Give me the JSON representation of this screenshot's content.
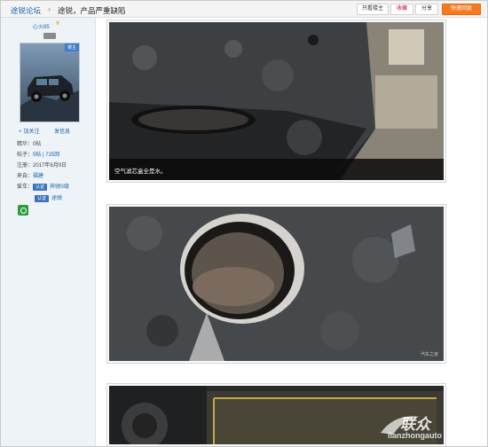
{
  "header": {
    "forum": "途锐论坛",
    "separator": "›",
    "thread_title": "途锐，产品严重缺陷",
    "buttons": {
      "only_author": "只看楼主",
      "favorite": "收藏",
      "share": "分享",
      "quick_reply": "快速回复"
    }
  },
  "sidebar": {
    "username": "心火85",
    "vip": "V",
    "avatar_tag": "楼主",
    "follow": "加关注",
    "message": "发信息",
    "stats": {
      "essence_label": "精华：",
      "essence_value": "0帖",
      "posts_label": "帖子：",
      "posts_value": "5帖 | 725回",
      "registered_label": "注册：",
      "registered_value": "2017年6月9日",
      "from_label": "来自：",
      "from_value": "福建",
      "car_label": "爱车：",
      "car_badge": "认证",
      "car_value": "奔驰S级",
      "car2_badge": "认证",
      "car2_value": "途锐"
    }
  },
  "photos": {
    "caption_1": "空气滤芯盒全是水。",
    "watermark": "汽车之家"
  },
  "corner_logo": {
    "text": "联众",
    "url": "lianzhongauto"
  },
  "colors": {
    "accent_blue": "#1a62a8",
    "reply_orange": "#f47a20",
    "sidebar_bg": "#eef3f8"
  }
}
